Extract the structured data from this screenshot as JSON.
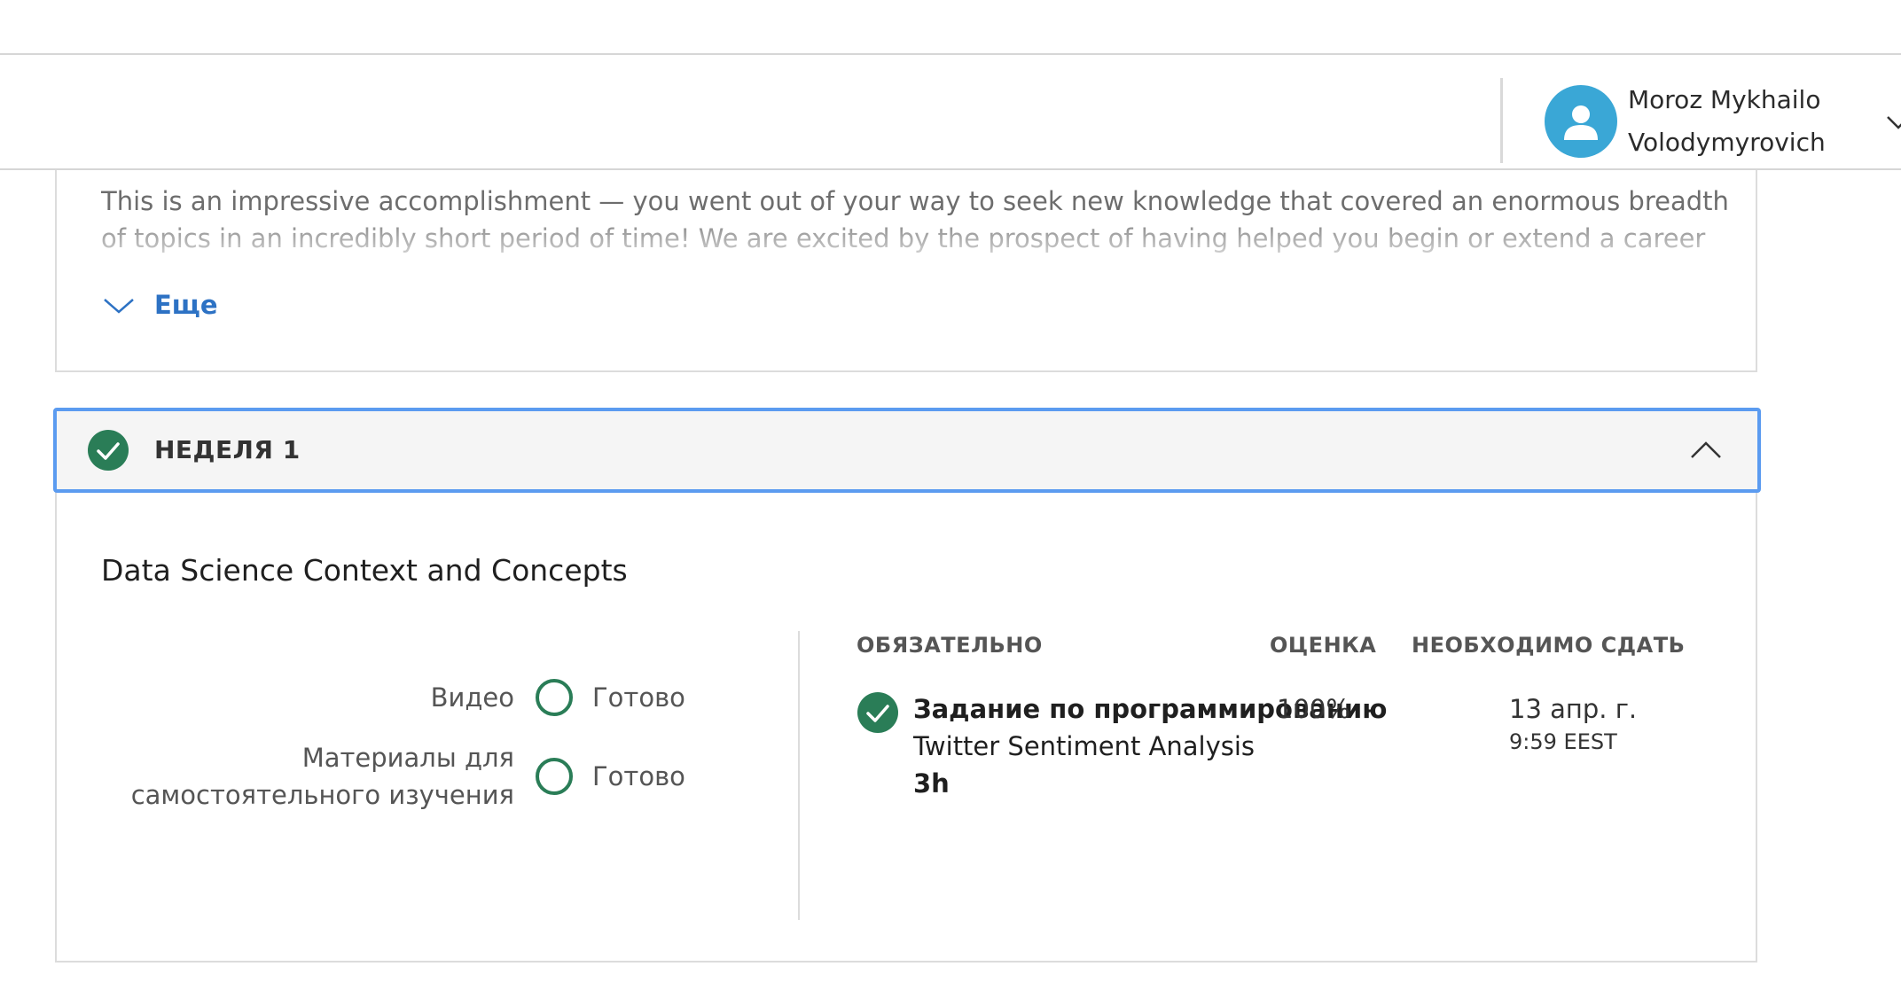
{
  "header": {
    "user_name_line1": "Moroz Mykhailo",
    "user_name_line2": "Volodymyrovich",
    "avatar_icon": "person-icon",
    "menu_icon": "chevron-down-icon"
  },
  "intro": {
    "text": "This is an impressive accomplishment — you went out of your way to seek new knowledge that covered an enormous breadth of topics in an incredibly short period of time! We are excited by the prospect of having helped you begin or extend a career in data science.",
    "more_label": "Еще"
  },
  "week": {
    "title": "НЕДЕЛЯ 1",
    "status_icon": "check-circle-icon",
    "collapse_icon": "chevron-up-icon",
    "module_title": "Data Science Context and Concepts",
    "summary": [
      {
        "label": "Видео",
        "status": "Готово"
      },
      {
        "label_line1": "Материалы для",
        "label_line2": "самостоятельного изучения",
        "status": "Готово"
      }
    ],
    "columns": {
      "required": "ОБЯЗАТЕЛЬНО",
      "grade": "ОЦЕНКА",
      "due": "НЕОБХОДИМО СДАТЬ"
    },
    "items": [
      {
        "type": "Задание по программированию",
        "name": "Twitter Sentiment Analysis",
        "duration": "3h",
        "grade": "100%",
        "due_date": "13 апр. г.",
        "due_time": "9:59 EEST"
      }
    ]
  },
  "colors": {
    "accent_blue": "#2d72c4",
    "success_green": "#2a7d57",
    "focus_outline": "#5b9bf0",
    "avatar_blue": "#3aa7d6"
  }
}
